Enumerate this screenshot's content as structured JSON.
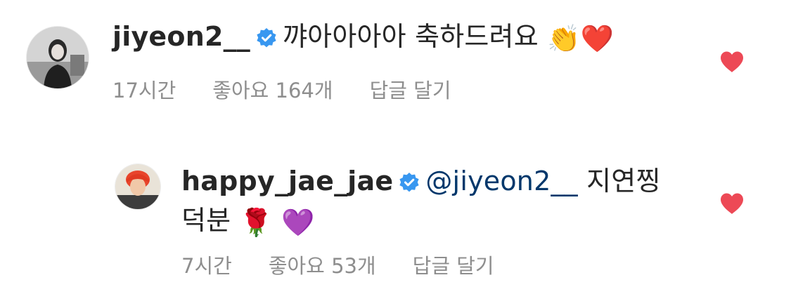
{
  "comments": [
    {
      "username": "jiyeon2__",
      "verified": true,
      "text": "꺄아아아아 축하드려요",
      "emojis": [
        "👏",
        "❤️"
      ],
      "time": "17시간",
      "likes": "좋아요 164개",
      "reply_label": "답글 달기",
      "liked": true
    },
    {
      "username": "happy_jae_jae",
      "verified": true,
      "mention": "@jiyeon2__",
      "text_line1": "지연찡",
      "text_line2": "덕분",
      "emojis": [
        "🌹",
        "💜"
      ],
      "time": "7시간",
      "likes": "좋아요 53개",
      "reply_label": "답글 달기",
      "liked": true
    }
  ],
  "colors": {
    "heart": "#ed4956",
    "verified": "#3897f0",
    "mention": "#00376b",
    "meta": "#8e8e8e"
  }
}
